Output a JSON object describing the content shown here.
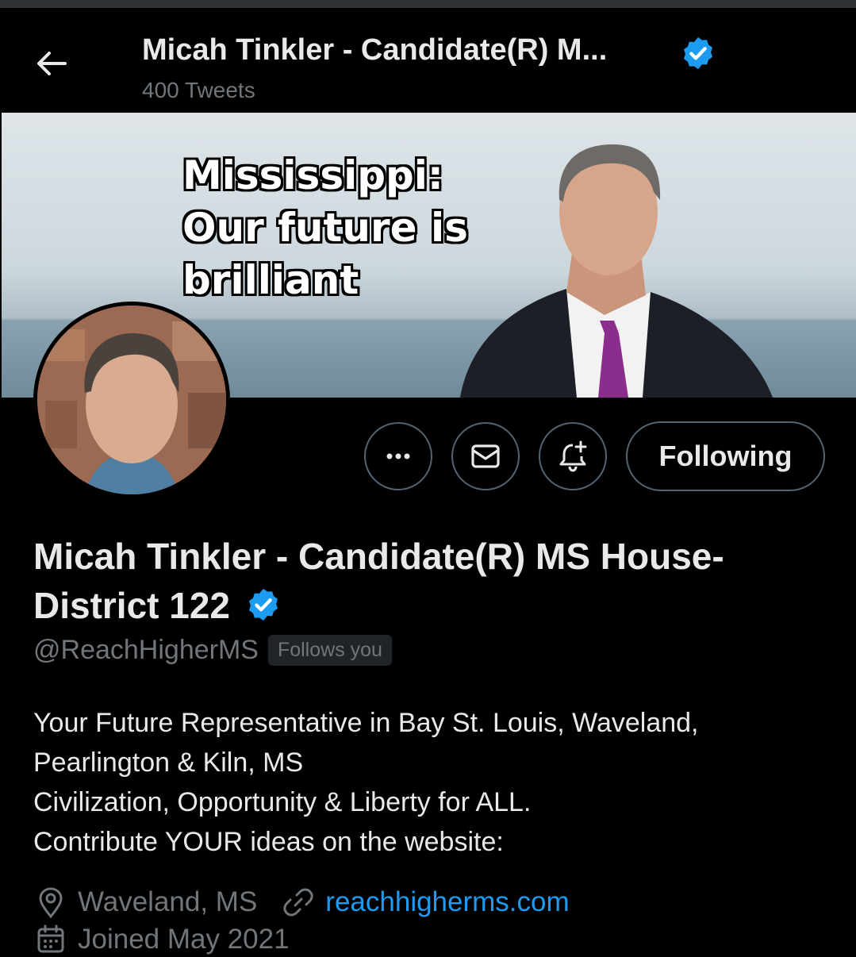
{
  "header": {
    "title": "Micah Tinkler - Candidate(R) M...",
    "tweet_count": "400 Tweets"
  },
  "banner": {
    "lines": [
      "Mississippi:",
      "Our future is",
      "brilliant"
    ]
  },
  "actions": {
    "more_icon": "more-horizontal-icon",
    "message_icon": "mail-icon",
    "notify_icon": "bell-plus-icon",
    "following_label": "Following"
  },
  "profile": {
    "name": "Micah Tinkler - Candidate(R) MS House-District 122",
    "handle": "@ReachHigherMS",
    "follows_you": "Follows you",
    "bio": [
      "Your Future Representative in Bay St. Louis, Waveland,",
      "Pearlington & Kiln, MS",
      "Civilization, Opportunity & Liberty for ALL.",
      "Contribute YOUR ideas on the website:"
    ],
    "location": "Waveland, MS",
    "website": "reachhigherms.com",
    "joined": "Joined May 2021"
  },
  "colors": {
    "accent": "#1d9bf0",
    "background": "#000000",
    "muted": "#71767b",
    "text": "#e7e9ea"
  }
}
